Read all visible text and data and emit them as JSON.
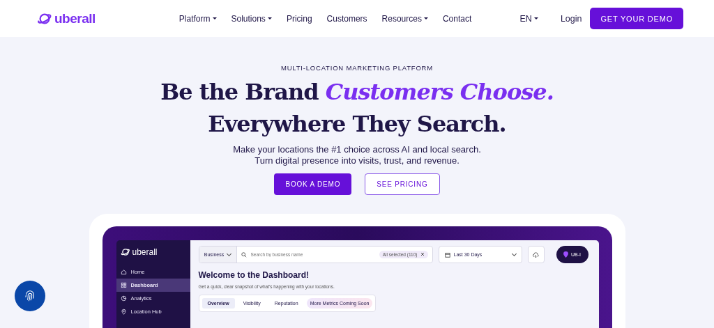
{
  "nav": {
    "logo": "uberall",
    "menu": [
      {
        "label": "Platform",
        "dropdown": true
      },
      {
        "label": "Solutions",
        "dropdown": true
      },
      {
        "label": "Pricing",
        "dropdown": false
      },
      {
        "label": "Customers",
        "dropdown": false
      },
      {
        "label": "Resources",
        "dropdown": true
      },
      {
        "label": "Contact",
        "dropdown": false
      }
    ],
    "language": "EN",
    "login": "Login",
    "cta": "GET YOUR DEMO"
  },
  "hero": {
    "eyebrow": "MULTI-LOCATION MARKETING PLATFORM",
    "headline": [
      "Be the Brand *Customers Choose.*",
      "Everywhere They Search."
    ],
    "subtitle": [
      "Make your locations the #1 choice across AI and local search.",
      "Turn digital presence into visits, trust, and revenue."
    ],
    "buttons": [
      {
        "label": "BOOK A DEMO",
        "kind": "primary"
      },
      {
        "label": "SEE PRICING",
        "kind": "outline"
      }
    ]
  },
  "dashboard": {
    "logo": "uberall",
    "sidebar": [
      {
        "label": "Home",
        "selected": false
      },
      {
        "label": "Dashboard",
        "selected": true
      },
      {
        "label": "Analytics",
        "selected": false
      },
      {
        "label": "Location Hub",
        "selected": false
      }
    ],
    "filter": "Business",
    "search": {
      "placeholder": "Search by business name"
    },
    "chip": "All selected (110)",
    "date": "Last 30 Days",
    "account": "UB-I",
    "title": "Welcome to the Dashboard!",
    "subtitle": "Get a quick, clear snapshot of what's happening with your locations.",
    "tabs": [
      {
        "label": "Overview",
        "kind": "tab",
        "selected": true
      },
      {
        "label": "Visibility",
        "kind": "tab",
        "selected": false
      },
      {
        "label": "Reputation",
        "kind": "tab",
        "selected": false
      },
      {
        "label": "More Metrics Coming Soon",
        "kind": "badge"
      }
    ]
  }
}
